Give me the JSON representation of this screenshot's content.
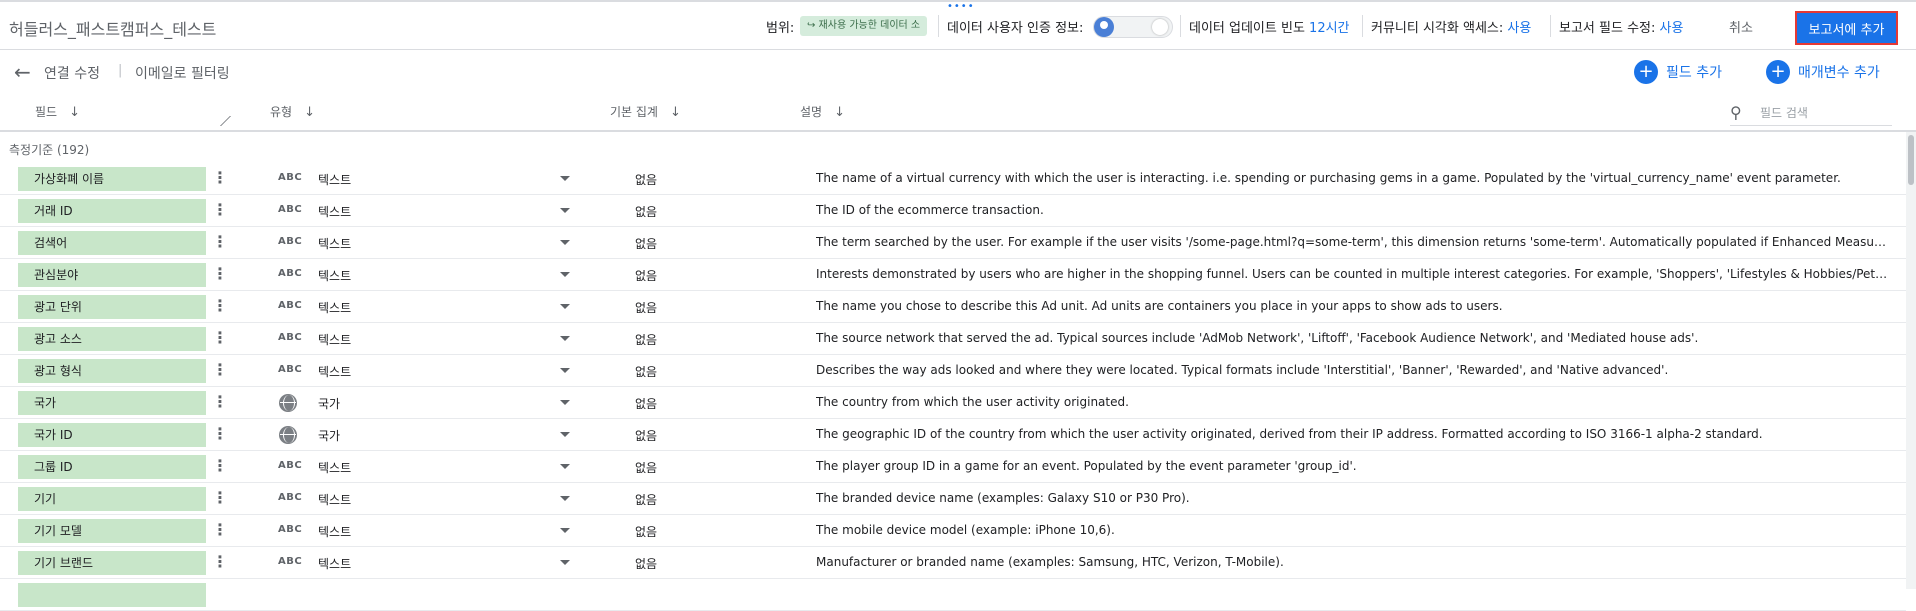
{
  "header": {
    "title": "허들러스_패스트캠퍼스_테스트",
    "scope_label": "범위:",
    "scope_chip": "↪ 재사용 가능한 데이터 소",
    "credentials_label": "데이터 사용자 인증 정보:",
    "freshness_label": "데이터 업데이트 빈도",
    "freshness_value": "12시간",
    "community_label": "커뮤니티 시각화 액세스:",
    "community_value": "사용",
    "edit_fields_label": "보고서 필드 수정:",
    "edit_fields_value": "사용",
    "cancel_label": "취소",
    "add_to_report_label": "보고서에 추가"
  },
  "subheader": {
    "edit_connection": "연결 수정",
    "separator": "|",
    "filter_by_email": "이메일로 필터링",
    "add_field": "필드 추가",
    "add_parameter": "매개변수 추가"
  },
  "columns": {
    "field": "필드",
    "type": "유형",
    "aggregation": "기본 집계",
    "description": "설명",
    "search_placeholder": "필드 검색"
  },
  "section_title": "측정기준 (192)",
  "rows": [
    {
      "name": "가상화폐 이름",
      "type_icon": "ABC",
      "type": "텍스트",
      "agg": "없음",
      "desc": "The name of a virtual currency with which the user is interacting. i.e. spending or purchasing gems in a game. Populated by the 'virtual_currency_name' event parameter."
    },
    {
      "name": "거래 ID",
      "type_icon": "ABC",
      "type": "텍스트",
      "agg": "없음",
      "desc": "The ID of the ecommerce transaction."
    },
    {
      "name": "검색어",
      "type_icon": "ABC",
      "type": "텍스트",
      "agg": "없음",
      "desc": "The term searched by the user. For example if the user visits '/some-page.html?q=some-term', this dimension returns 'some-term'. Automatically populated if Enhanced Measurement is enabled. Popula..."
    },
    {
      "name": "관심분야",
      "type_icon": "ABC",
      "type": "텍스트",
      "agg": "없음",
      "desc": "Interests demonstrated by users who are higher in the shopping funnel. Users can be counted in multiple interest categories. For example, 'Shoppers', 'Lifestyles & Hobbies/Pet Lovers', or 'Travel/Travel ..."
    },
    {
      "name": "광고 단위",
      "type_icon": "ABC",
      "type": "텍스트",
      "agg": "없음",
      "desc": "The name you chose to describe this Ad unit. Ad units are containers you place in your apps to show ads to users."
    },
    {
      "name": "광고 소스",
      "type_icon": "ABC",
      "type": "텍스트",
      "agg": "없음",
      "desc": "The source network that served the ad. Typical sources include 'AdMob Network', 'Liftoff', 'Facebook Audience Network', and 'Mediated house ads'."
    },
    {
      "name": "광고 형식",
      "type_icon": "ABC",
      "type": "텍스트",
      "agg": "없음",
      "desc": "Describes the way ads looked and where they were located. Typical formats include 'Interstitial', 'Banner', 'Rewarded', and 'Native advanced'."
    },
    {
      "name": "국가",
      "type_icon": "globe",
      "type": "국가",
      "agg": "없음",
      "desc": "The country from which the user activity originated."
    },
    {
      "name": "국가 ID",
      "type_icon": "globe",
      "type": "국가",
      "agg": "없음",
      "desc": "The geographic ID of the country from which the user activity originated, derived from their IP address. Formatted according to ISO 3166-1 alpha-2 standard."
    },
    {
      "name": "그룹 ID",
      "type_icon": "ABC",
      "type": "텍스트",
      "agg": "없음",
      "desc": "The player group ID in a game for an event. Populated by the event parameter 'group_id'."
    },
    {
      "name": "기기",
      "type_icon": "ABC",
      "type": "텍스트",
      "agg": "없음",
      "desc": "The branded device name (examples: Galaxy S10 or P30 Pro)."
    },
    {
      "name": "기기 모델",
      "type_icon": "ABC",
      "type": "텍스트",
      "agg": "없음",
      "desc": "The mobile device model (example: iPhone 10,6)."
    },
    {
      "name": "기기 브랜드",
      "type_icon": "ABC",
      "type": "텍스트",
      "agg": "없음",
      "desc": "Manufacturer or branded name (examples: Samsung, HTC, Verizon, T-Mobile)."
    }
  ]
}
